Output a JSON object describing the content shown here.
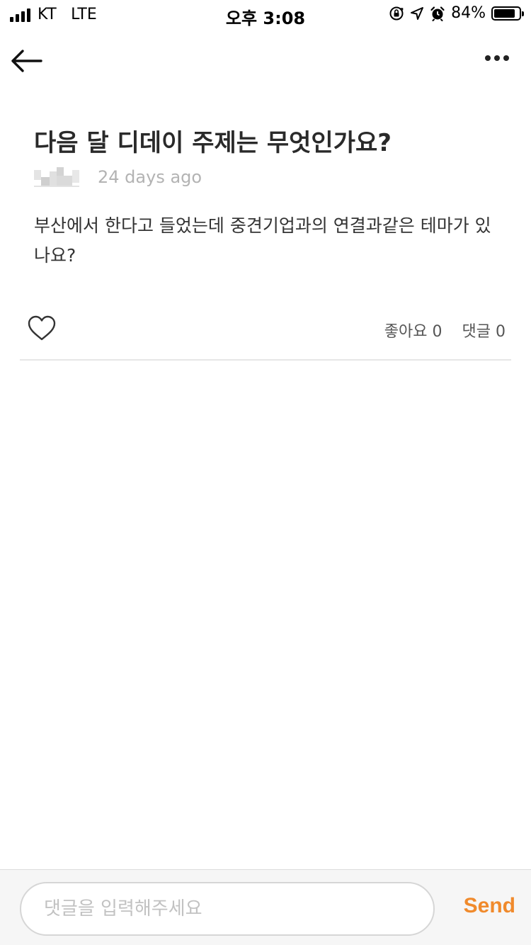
{
  "status_bar": {
    "carrier": "KT",
    "network": "LTE",
    "time": "오후 3:08",
    "battery_percent": "84%",
    "battery_level": 0.84,
    "icons": [
      "signal-icon",
      "rotation-lock-icon",
      "location-icon",
      "alarm-icon",
      "battery-icon"
    ]
  },
  "nav": {
    "back_icon": "arrow-left-icon",
    "more_icon": "more-horizontal-icon"
  },
  "post": {
    "title": "다음 달 디데이 주제는 무엇인가요?",
    "date": "24 days ago",
    "body": "부산에서 한다고 들었는데 중견기업과의 연결과같은 테마가 있나요?"
  },
  "actions": {
    "like_icon": "heart-outline-icon",
    "likes_text": "좋아요 0",
    "comments_text": "댓글 0"
  },
  "comment_bar": {
    "placeholder": "댓글을 입력해주세요",
    "send_label": "Send"
  },
  "colors": {
    "accent": "#f08a2c",
    "muted_text": "#b3b3b3",
    "divider": "#e6e6e6"
  }
}
